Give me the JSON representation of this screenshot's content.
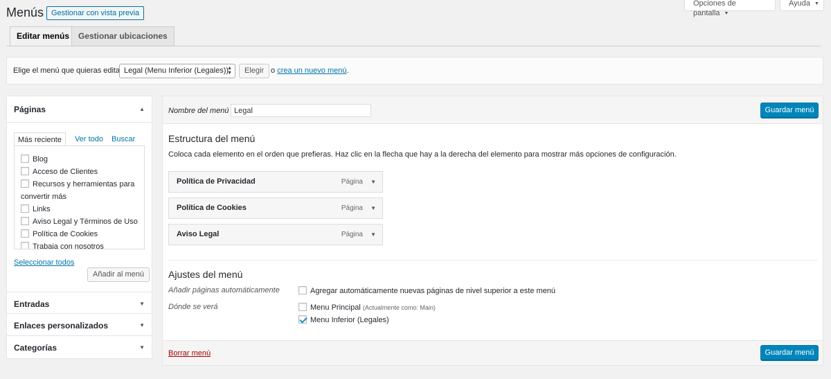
{
  "header": {
    "title": "Menús",
    "preview_button": "Gestionar con vista previa",
    "screen_options": "Opciones de pantalla",
    "help": "Ayuda"
  },
  "tabs": [
    {
      "label": "Editar menús",
      "active": true
    },
    {
      "label": "Gestionar ubicaciones",
      "active": false
    }
  ],
  "manage_bar": {
    "label": "Elige el menú que quieras editar:",
    "selected_menu": "Legal (Menu Inferior (Legales))",
    "select_button": "Elegir",
    "or_text": "o",
    "create_link": "crea un nuevo menú",
    "period": "."
  },
  "left_panel": {
    "pages_title": "Páginas",
    "subtabs": [
      "Más reciente",
      "Ver todo",
      "Buscar"
    ],
    "pages": [
      "Blog",
      "Acceso de Clientes",
      "Recursos y herramientas para",
      "convertir más",
      "Links",
      "Aviso Legal y Términos de Uso",
      "Política de Cookies",
      "Trabaja con nosotros"
    ],
    "select_all": "Seleccionar todos",
    "add_button": "Añadir al menú",
    "sections": [
      "Entradas",
      "Enlaces personalizados",
      "Categorías"
    ]
  },
  "right_panel": {
    "name_label": "Nombre del menú",
    "name_value": "Legal",
    "save_button": "Guardar menú",
    "structure_title": "Estructura del menú",
    "structure_desc": "Coloca cada elemento en el orden que prefieras. Haz clic en la flecha que hay a la derecha del elemento para mostrar más opciones de configuración.",
    "items": [
      {
        "title": "Política de Privacidad",
        "type": "Página"
      },
      {
        "title": "Política de Cookies",
        "type": "Página"
      },
      {
        "title": "Aviso Legal",
        "type": "Página"
      }
    ],
    "settings_title": "Ajustes del menú",
    "auto_add_label": "Añadir páginas automáticamente",
    "auto_add_option": "Agregar automáticamente nuevas páginas de nivel superior a este menú",
    "location_label": "Dónde se verá",
    "location_main": "Menu Principal",
    "location_main_note": "(Actualmente como: Main)",
    "location_footer": "Menu Inferior (Legales)",
    "delete_link": "Borrar menú"
  },
  "icons": {
    "caret_up": "▲",
    "caret_down": "▼",
    "select_arrows": "▲▼"
  }
}
